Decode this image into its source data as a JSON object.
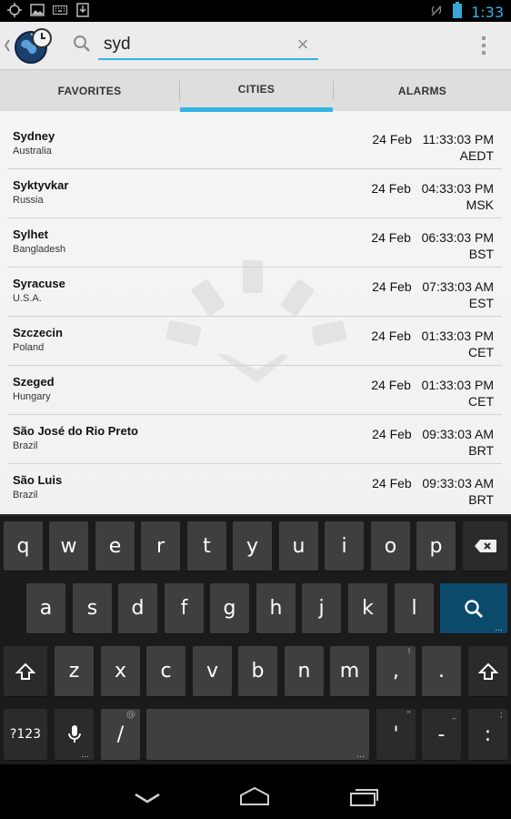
{
  "status_bar": {
    "time": "1:33",
    "left_icons": [
      "gps-icon",
      "image-icon",
      "keyboard-icon",
      "download-icon"
    ],
    "right_icons": [
      "signal-off-icon",
      "battery-icon"
    ]
  },
  "action_bar": {
    "app_icon": "world-clock-icon",
    "search_value": "syd",
    "clear_icon": "close-icon",
    "overflow_icon": "overflow-menu-icon"
  },
  "tabs": [
    {
      "label": "FAVORITES",
      "selected": false
    },
    {
      "label": "CITIES",
      "selected": true
    },
    {
      "label": "ALARMS",
      "selected": false
    }
  ],
  "cities": [
    {
      "name": "Sydney",
      "country": "Australia",
      "date": "24 Feb",
      "time": "11:33:03 PM",
      "tz": "AEDT"
    },
    {
      "name": "Syktyvkar",
      "country": "Russia",
      "date": "24 Feb",
      "time": "04:33:03 PM",
      "tz": "MSK"
    },
    {
      "name": "Sylhet",
      "country": "Bangladesh",
      "date": "24 Feb",
      "time": "06:33:03 PM",
      "tz": "BST"
    },
    {
      "name": "Syracuse",
      "country": "U.S.A.",
      "date": "24 Feb",
      "time": "07:33:03 AM",
      "tz": "EST"
    },
    {
      "name": "Szczecin",
      "country": "Poland",
      "date": "24 Feb",
      "time": "01:33:03 PM",
      "tz": "CET"
    },
    {
      "name": "Szeged",
      "country": "Hungary",
      "date": "24 Feb",
      "time": "01:33:03 PM",
      "tz": "CET"
    },
    {
      "name": "São José do Rio Preto",
      "country": "Brazil",
      "date": "24 Feb",
      "time": "09:33:03 AM",
      "tz": "BRT"
    },
    {
      "name": "São Luis",
      "country": "Brazil",
      "date": "24 Feb",
      "time": "09:33:03 AM",
      "tz": "BRT"
    }
  ],
  "keyboard": {
    "row1": [
      "q",
      "w",
      "e",
      "r",
      "t",
      "y",
      "u",
      "i",
      "o",
      "p"
    ],
    "row2": [
      "a",
      "s",
      "d",
      "f",
      "g",
      "h",
      "j",
      "k",
      "l"
    ],
    "row3": [
      "z",
      "x",
      "c",
      "v",
      "b",
      "n",
      "m",
      ",",
      "."
    ],
    "row3_hints": {
      ",": "!",
      ".": "?"
    },
    "numbers_label": "?123",
    "slash": "/",
    "slash_hint": "@",
    "apostrophe": "'",
    "apostrophe_hint": "\"",
    "dash": "-",
    "dash_hint": "_",
    "colon": ":",
    "colon_hint": ";",
    "icons": [
      "backspace-icon",
      "search-key-icon",
      "shift-icon",
      "microphone-icon"
    ]
  },
  "nav_bar": {
    "icons": [
      "back-icon",
      "home-icon",
      "recents-icon"
    ]
  },
  "colors": {
    "accent": "#33b5e5",
    "status_time": "#2fb6e5",
    "search_key": "#0b4a6b"
  }
}
